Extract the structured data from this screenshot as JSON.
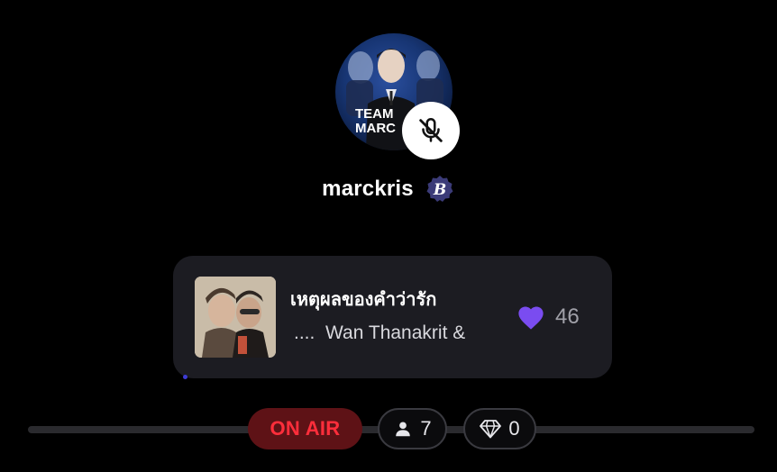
{
  "host": {
    "username": "marckris",
    "verified_badge_letter": "B",
    "avatar_text": "TEAM MARC"
  },
  "now_playing": {
    "title": "เหตุผลของคำว่ารัก",
    "artist": "....  Wan Thanakrit &",
    "likes": "46"
  },
  "status": {
    "on_air_label": "ON AIR",
    "listeners": "7",
    "gems": "0"
  },
  "colors": {
    "background": "#000000",
    "card": "#1c1c22",
    "heart": "#7a4cf0",
    "on_air_text": "#ff2e3b",
    "on_air_bg": "#5e1216",
    "badge": "#3b3b78"
  },
  "icons": {
    "mic": "microphone-off-icon",
    "like": "heart-icon",
    "listeners": "person-icon",
    "gems": "diamond-icon"
  }
}
